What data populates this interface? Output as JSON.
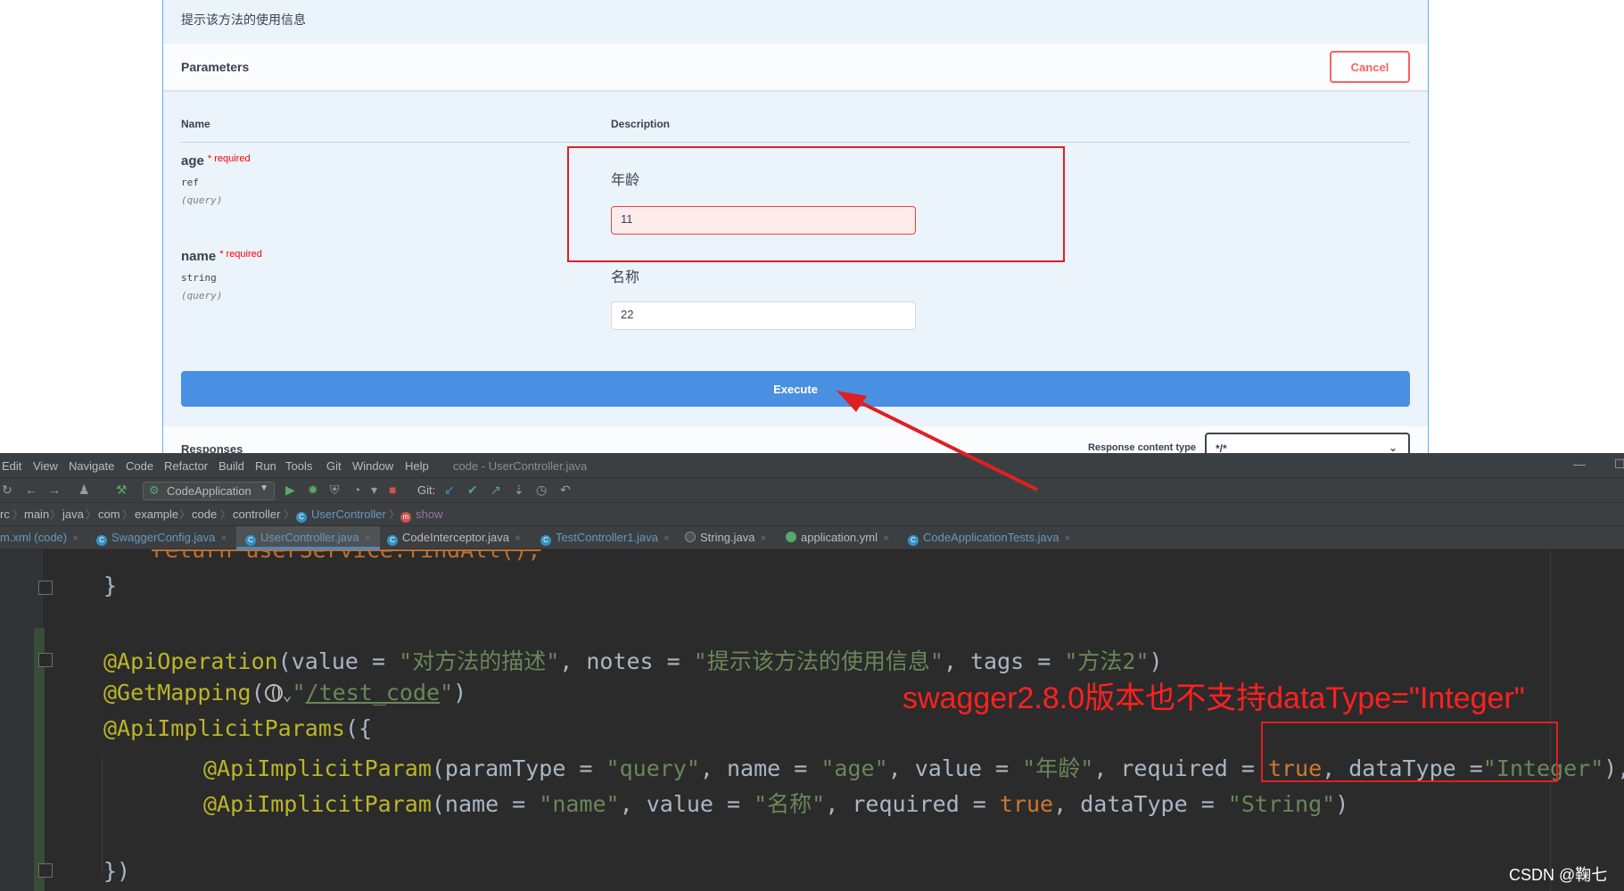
{
  "swagger": {
    "notes": "提示该方法的使用信息",
    "parameters_title": "Parameters",
    "cancel_label": "Cancel",
    "col_name": "Name",
    "col_description": "Description",
    "params": [
      {
        "name": "age",
        "required_mark": "*",
        "required_label": "required",
        "type": "ref",
        "in": "(query)",
        "description": "年龄",
        "value": "11"
      },
      {
        "name": "name",
        "required_mark": "*",
        "required_label": "required",
        "type": "string",
        "in": "(query)",
        "description": "名称",
        "value": "22"
      }
    ],
    "execute_label": "Execute",
    "responses_label": "Responses",
    "response_content_type_label": "Response content type",
    "response_content_type_value": "*/*"
  },
  "ide": {
    "menu": [
      "Edit",
      "View",
      "Navigate",
      "Code",
      "Refactor",
      "Build",
      "Run",
      "Tools",
      "Git",
      "Window",
      "Help"
    ],
    "title": "code - UserController.java",
    "run_config": "CodeApplication",
    "git_label": "Git:",
    "breadcrumb": [
      "rc",
      "main",
      "java",
      "com",
      "example",
      "code",
      "controller",
      "UserController",
      "show"
    ],
    "tabs": [
      {
        "label": "m.xml (code)"
      },
      {
        "label": "SwaggerConfig.java"
      },
      {
        "label": "UserController.java",
        "active": true
      },
      {
        "label": "CodeInterceptor.java"
      },
      {
        "label": "TestController1.java"
      },
      {
        "label": "String.java"
      },
      {
        "label": "application.yml"
      },
      {
        "label": "CodeApplicationTests.java"
      }
    ],
    "tab_close": "×",
    "code": {
      "l0": "return userService.findAll();",
      "l1": "}",
      "l3_ann": "@ApiOperation",
      "l3_a": "(value = ",
      "l3_s1": "\"对方法的描述\"",
      "l3_b": ", notes = ",
      "l3_s2": "\"提示该方法的使用信息\"",
      "l3_c": ", tags = ",
      "l3_s3": "\"方法2\"",
      "l3_d": ")",
      "l4_ann": "@GetMapping",
      "l4_a": "(",
      "l4_chev": "⌄",
      "l4_q1": "\"",
      "l4_link": "/test_code",
      "l4_q2": "\"",
      "l4_b": ")",
      "l5_ann": "@ApiImplicitParams",
      "l5_a": "({",
      "l6_ann": "@ApiImplicitParam",
      "l6_a": "(paramType = ",
      "l6_s1": "\"query\"",
      "l6_b": ", name = ",
      "l6_s2": "\"age\"",
      "l6_c": ", value = ",
      "l6_s3": "\"年龄\"",
      "l6_d": ", required = ",
      "l6_kw": "true",
      "l6_e": ", dataType =",
      "l6_s4": "\"Integer\"",
      "l6_f": "),",
      "l7_ann": "@ApiImplicitParam",
      "l7_a": "(name = ",
      "l7_s1": "\"name\"",
      "l7_b": ", value = ",
      "l7_s2": "\"名称\"",
      "l7_c": ", required = ",
      "l7_kw": "true",
      "l7_d": ", dataType = ",
      "l7_s3": "\"String\"",
      "l7_e": ")",
      "l9": "})"
    }
  },
  "annotation_text": "swagger2.8.0版本也不支持dataType=\"Integer\"",
  "watermark": "CSDN @鞠七",
  "colors": {
    "swagger_blue": "#4990e2",
    "cancel_red": "#ff6060",
    "annotation_red": "#ff2020",
    "ide_bg": "#2b2b2b"
  }
}
